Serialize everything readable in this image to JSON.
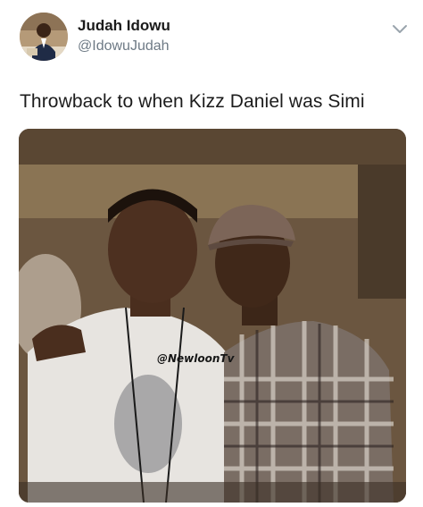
{
  "user": {
    "display_name": "Judah Idowu",
    "handle": "@IdowuJudah"
  },
  "tweet": {
    "text": "Throwback to when Kizz Daniel was Simi"
  },
  "photo": {
    "watermark": "@NewloonTv"
  },
  "icons": {
    "menu": "chevron-down-icon",
    "avatar": "avatar"
  },
  "colors": {
    "text": "#1c1c1c",
    "handle": "#6e7a85",
    "photo_border": "#3b2f24"
  }
}
